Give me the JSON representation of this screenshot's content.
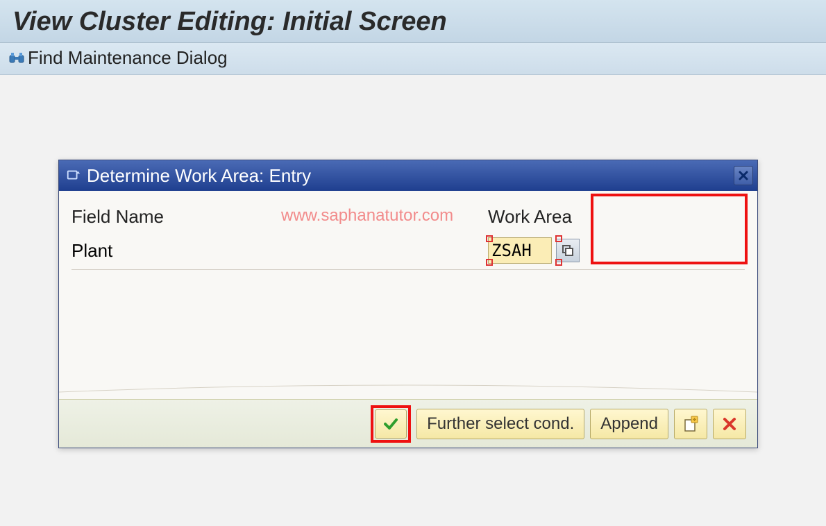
{
  "header": {
    "title": "View Cluster Editing: Initial Screen"
  },
  "toolbar": {
    "find_label": "Find Maintenance Dialog"
  },
  "watermark": "www.saphanatutor.com",
  "dialog": {
    "title": "Determine Work Area: Entry",
    "columns": {
      "field": "Field Name",
      "work": "Work Area"
    },
    "row": {
      "label": "Plant",
      "value": "ZSAH"
    },
    "buttons": {
      "ok": "OK",
      "further": "Further select cond.",
      "append": "Append",
      "new_entries": "New entries",
      "cancel": "Cancel"
    }
  }
}
